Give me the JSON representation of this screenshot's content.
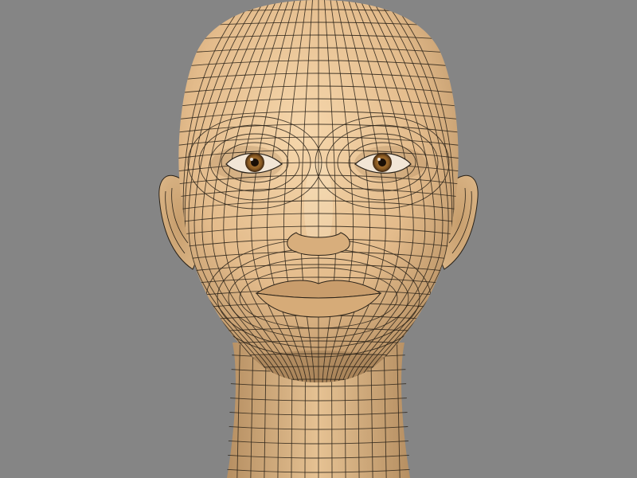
{
  "scene": {
    "background_color": "#858585",
    "skin_color": "#e3bb8b",
    "skin_highlight": "#f6d7ac",
    "skin_shadow": "#a98357",
    "wire_color": "#2a2218",
    "iris_color": "#8a5a22",
    "pupil_color": "#1a0f06"
  }
}
